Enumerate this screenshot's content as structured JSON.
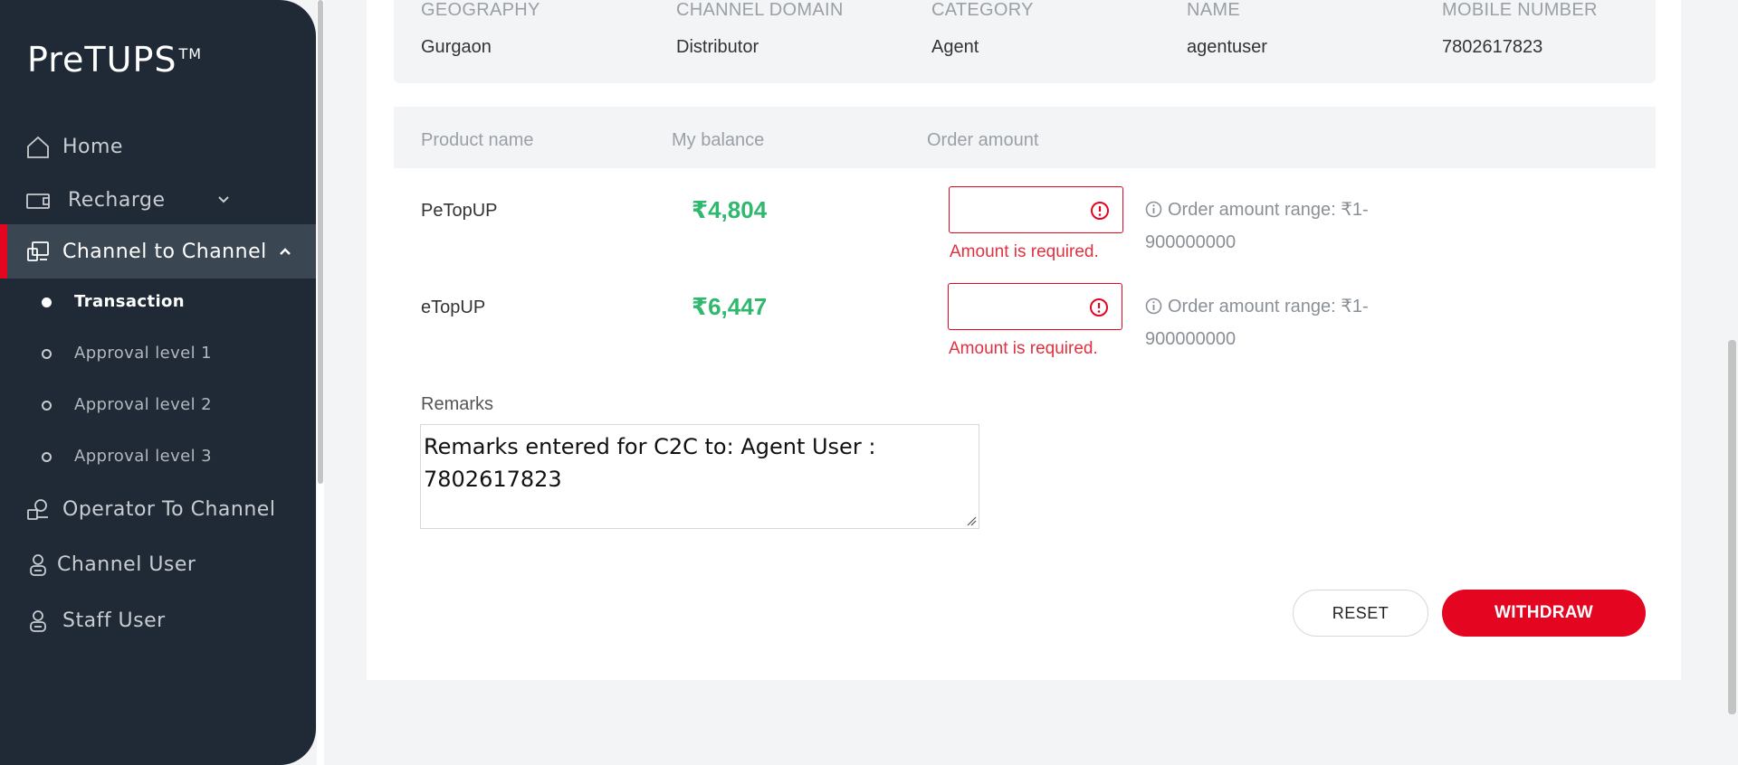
{
  "brand": {
    "name": "PreTUPS",
    "mark": "TM"
  },
  "sidebar": {
    "items": [
      {
        "label": "Home"
      },
      {
        "label": "Recharge"
      },
      {
        "label": "Channel to Channel"
      },
      {
        "label": "Operator To Channel"
      },
      {
        "label": "Channel User"
      },
      {
        "label": "Staff User"
      }
    ],
    "sub_items": [
      {
        "label": "Transaction"
      },
      {
        "label": "Approval level 1"
      },
      {
        "label": "Approval level 2"
      },
      {
        "label": "Approval level 3"
      }
    ]
  },
  "info": {
    "columns": [
      {
        "head": "GEOGRAPHY",
        "value": "Gurgaon"
      },
      {
        "head": "CHANNEL DOMAIN",
        "value": "Distributor"
      },
      {
        "head": "CATEGORY",
        "value": "Agent"
      },
      {
        "head": "NAME",
        "value": "agentuser"
      },
      {
        "head": "MOBILE NUMBER",
        "value": "7802617823"
      }
    ]
  },
  "products": {
    "headers": {
      "name": "Product name",
      "balance": "My balance",
      "order": "Order amount"
    },
    "rows": [
      {
        "name": "PeTopUP",
        "balance": "₹4,804",
        "error": "Amount is required.",
        "range": "Order amount range: ₹1-900000000"
      },
      {
        "name": "eTopUP",
        "balance": "₹6,447",
        "error": "Amount is required.",
        "range": "Order amount range: ₹1-900000000"
      }
    ]
  },
  "remarks": {
    "label": "Remarks",
    "value": "Remarks entered for C2C to: Agent User : 7802617823"
  },
  "actions": {
    "reset": "RESET",
    "withdraw": "WITHDRAW"
  },
  "colors": {
    "accent": "#e40521",
    "sidebar": "#1f2a36",
    "balance": "#2fb86e"
  }
}
